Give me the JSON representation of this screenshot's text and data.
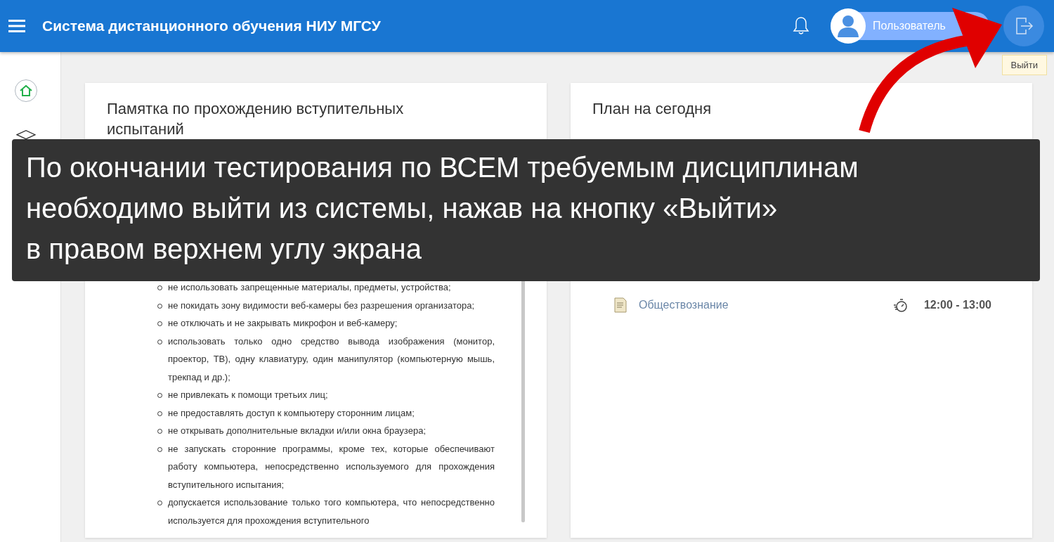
{
  "header": {
    "title": "Система дистанционного обучения НИУ МГСУ",
    "user": "Пользователь",
    "logout_tooltip": "Выйти"
  },
  "memo_card": {
    "title": "Памятка по прохождению вступительных испытаний",
    "rules": [
      "не использовать запрещенные материалы, предметы, устройства;",
      "не покидать зону видимости веб-камеры без разрешения организатора;",
      "не отключать и не закрывать микрофон и веб-камеру;",
      "использовать только одно средство вывода изображения (монитор, проектор, ТВ), одну клавиатуру, один манипулятор (компьютерную мышь, трекпад и др.);",
      "не привлекать к помощи третьих лиц;",
      "не предоставлять доступ к компьютеру сторонним лицам;",
      "не открывать дополнительные вкладки и/или окна браузера;",
      "не запускать сторонние программы, кроме тех, которые обеспечивают работу компьютера, непосредственно используемого для прохождения вступительного испытания;",
      "допускается использование только того компьютера, что непосредственно используется для прохождения вступительного"
    ]
  },
  "plan_card": {
    "title": "План на сегодня",
    "items": [
      {
        "subject": "Обществознание",
        "time": "12:00 - 13:00"
      }
    ]
  },
  "notice": {
    "lines": [
      "По окончании тестирования по ВСЕМ требуемым дисциплинам",
      "необходимо выйти из системы, нажав на кнопку «Выйти»",
      "в правом верхнем углу экрана"
    ]
  }
}
